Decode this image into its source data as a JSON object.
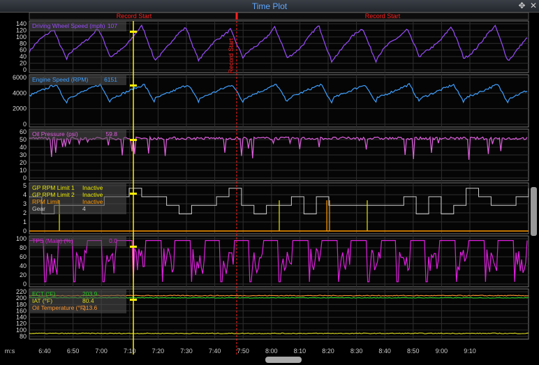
{
  "window": {
    "title": "Time Plot",
    "move_icon": "✥",
    "close_icon": "✕"
  },
  "markers": [
    {
      "label": "Record Start",
      "side": "left"
    },
    {
      "label": "Record Start",
      "side": "right"
    }
  ],
  "cursor_marker_label": "Record Start",
  "x_axis": {
    "unit_label": "m:s",
    "ticks": [
      "6:40",
      "6:50",
      "7:00",
      "7:10",
      "7:20",
      "7:30",
      "7:40",
      "7:50",
      "8:00",
      "8:10",
      "8:20",
      "8:30",
      "8:40",
      "8:50",
      "9:00",
      "9:10"
    ]
  },
  "panels": [
    {
      "name": "driving-wheel-speed",
      "y_ticks": [
        "140",
        "120",
        "100",
        "80",
        "60",
        "40",
        "20",
        "0"
      ],
      "ymin": 0,
      "ymax": 145,
      "channels": [
        {
          "label": "Driving Wheel Speed (mph)",
          "value": "107",
          "color": "#9b4dff"
        }
      ]
    },
    {
      "name": "engine-speed",
      "y_ticks": [
        "6000",
        "4000",
        "2000",
        "0"
      ],
      "ymin": 0,
      "ymax": 7200,
      "channels": [
        {
          "label": "Engine Speed (RPM)",
          "value": "6151",
          "color": "#3fa0ff"
        }
      ]
    },
    {
      "name": "oil-pressure",
      "y_ticks": [
        "60",
        "50",
        "40",
        "30",
        "20",
        "10",
        "0"
      ],
      "ymin": 0,
      "ymax": 66,
      "channels": [
        {
          "label": "Oil Pressure (psi)",
          "value": "59.8",
          "color": "#e060e0"
        }
      ]
    },
    {
      "name": "rpm-limits-gear",
      "y_ticks": [
        "5",
        "4",
        "3",
        "2",
        "1",
        "0"
      ],
      "ymin": 0,
      "ymax": 5.3,
      "channels": [
        {
          "label": "GP RPM Limit 1",
          "value": "Inactive",
          "color": "#e8e800"
        },
        {
          "label": "GP RPM Limit 2",
          "value": "Inactive",
          "color": "#e8e800"
        },
        {
          "label": "RPM Limit",
          "value": "Inactive",
          "color": "#ff9900"
        },
        {
          "label": "Gear",
          "value": "4",
          "color": "#cccccc"
        }
      ]
    },
    {
      "name": "tps-main",
      "y_ticks": [
        "100",
        "80",
        "60",
        "40",
        "20",
        "0"
      ],
      "ymin": 0,
      "ymax": 106,
      "channels": [
        {
          "label": "TPS (Main) (%)",
          "value": "0.0",
          "color": "#e020e0"
        }
      ]
    },
    {
      "name": "temperatures",
      "y_ticks": [
        "220",
        "200",
        "180",
        "160",
        "140",
        "120",
        "100",
        "80"
      ],
      "ymin": 75,
      "ymax": 224,
      "channels": [
        {
          "label": "ECT (°F)",
          "value": "203.9",
          "color": "#22cc22"
        },
        {
          "label": "IAT (°F)",
          "value": "80.4",
          "color": "#dddd22"
        },
        {
          "label": "Oil Temperature (°F)",
          "value": "213.6",
          "color": "#ff9933"
        }
      ]
    }
  ],
  "colors": {
    "cursor": "#ffee00",
    "marker": "#ff2020",
    "grid": "#2e2e2e",
    "border": "#777"
  }
}
